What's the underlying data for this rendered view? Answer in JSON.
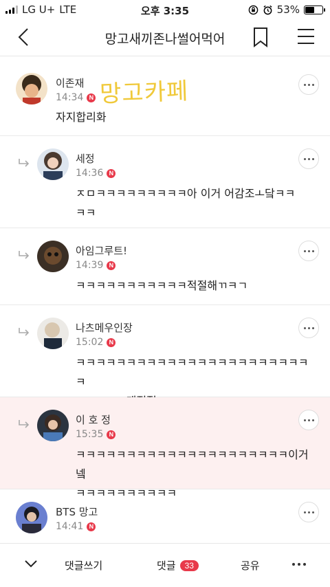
{
  "status": {
    "carrier": "LG U+",
    "network": "LTE",
    "time": "오후 3:35",
    "battery": "53%",
    "battery_level": 0.53
  },
  "nav": {
    "title": "망고새끼존나썰어먹어"
  },
  "comments": [
    {
      "author": "이존재",
      "time": "14:34",
      "text": "자지합리화",
      "overlay": "망고카페",
      "reply": false
    },
    {
      "author": "세정",
      "time": "14:36",
      "text": "ㅈㅁㅋㅋㅋㅋㅋㅋㅋㅋㅋ아 이거 어감조ㅗ닼ㅋㅋ\nㅋㅋ",
      "reply": true
    },
    {
      "author": "아임그루트!",
      "time": "14:39",
      "text": "ㅋㅋㅋㅋㅋㅋㅋㅋㅋㅋㅋ적절해ㄲㅋㄱ",
      "reply": true
    },
    {
      "author": "나츠메우인장",
      "time": "15:02",
      "text": "ㅋㅋㅋㅋㅋㅋㅋㅋㅋㅋㅋㅋㅋㅋㅋㅋㅋㅋㅋㅋㅋㅋㅋㅋ\nㅋㅋㅋㅋㅋ개적절",
      "reply": true
    },
    {
      "author": "이 호 정",
      "time": "15:35",
      "text": "ㅋㅋㅋㅋㅋㅋㅋㅋㅋㅋㅋㅋㅋㅋㅋㅋㅋㅋㅋㅋㅋ이거넼\nㅋㅋㅋㅋㅋㅋㅋㅋㅋㅋ",
      "reply": true,
      "highlight": true
    },
    {
      "author": "BTS 망고",
      "time": "14:41",
      "text": "",
      "reply": false
    }
  ],
  "new_badge": "N",
  "bottom_bar": {
    "write": "댓글쓰기",
    "comments": "댓글",
    "count": "33",
    "share": "공유"
  },
  "colors": {
    "badge": "#e8394a",
    "highlight_bg": "#fdf0f0",
    "overlay": "#f0c93a"
  },
  "icons": [
    "back-icon",
    "bookmark-icon",
    "menu-icon",
    "reply-arrow-icon",
    "more-icon",
    "chevron-down-icon",
    "alarm-icon",
    "rotation-lock-icon"
  ]
}
